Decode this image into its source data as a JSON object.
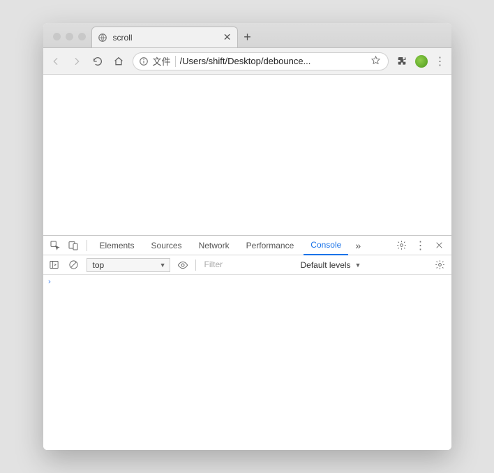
{
  "tab": {
    "title": "scroll"
  },
  "omnibox": {
    "protocol_label": "文件",
    "url": "/Users/shift/Desktop/debounce..."
  },
  "devtools": {
    "tabs": [
      "Elements",
      "Sources",
      "Network",
      "Performance",
      "Console"
    ],
    "active_tab": "Console",
    "console": {
      "context": "top",
      "filter_placeholder": "Filter",
      "levels": "Default levels"
    }
  }
}
